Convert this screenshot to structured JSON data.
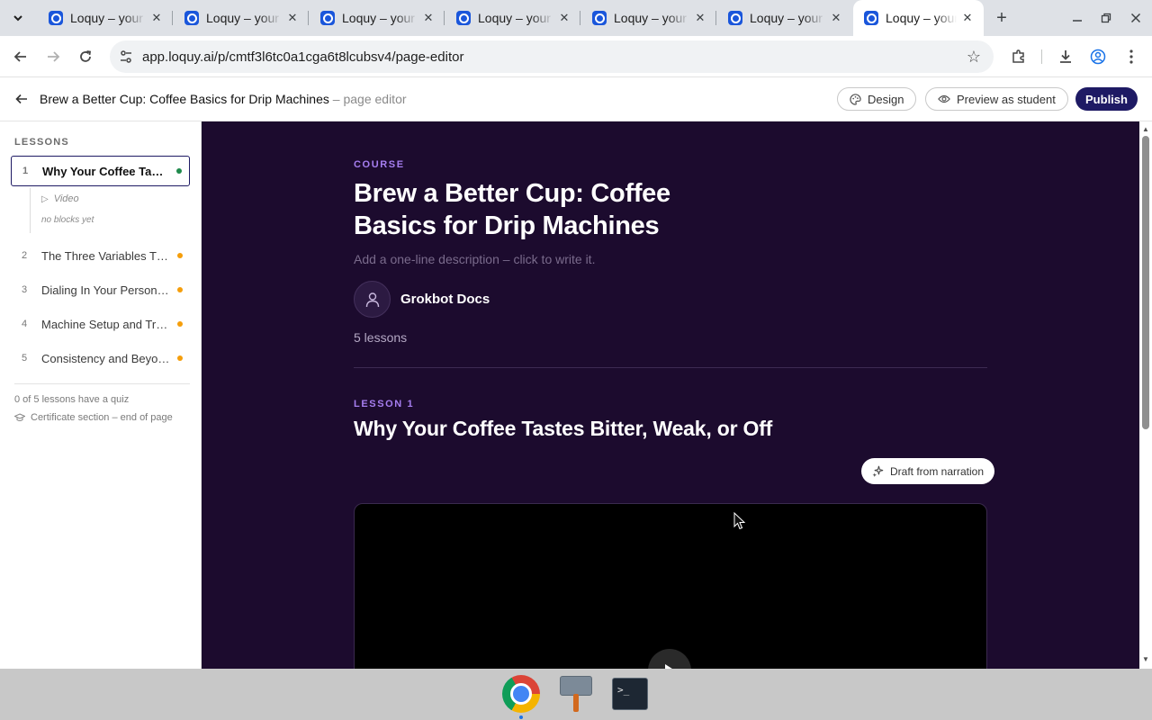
{
  "browser": {
    "tabs": [
      {
        "title": "Loquy – your"
      },
      {
        "title": "Loquy – your"
      },
      {
        "title": "Loquy – your"
      },
      {
        "title": "Loquy – your"
      },
      {
        "title": "Loquy – your"
      },
      {
        "title": "Loquy – your"
      },
      {
        "title": "Loquy – your"
      }
    ],
    "url": "app.loquy.ai/p/cmtf3l6tc0a1cga6t8lcubsv4/page-editor"
  },
  "header": {
    "course_title": "Brew a Better Cup: Coffee Basics for Drip Machines",
    "suffix": " – page editor",
    "design_label": "Design",
    "preview_label": "Preview as student",
    "publish_label": "Publish"
  },
  "sidebar": {
    "heading": "LESSONS",
    "lessons": [
      {
        "num": "1",
        "name": "Why Your Coffee Tastes Bitter, Weak, or Off",
        "status_color": "#1f8a4c"
      },
      {
        "num": "2",
        "name": "The Three Variables That Matter Most",
        "status_color": "#f59e0b"
      },
      {
        "num": "3",
        "name": "Dialing In Your Personal Recipe",
        "status_color": "#f59e0b"
      },
      {
        "num": "4",
        "name": "Machine Setup and Troubleshooting",
        "status_color": "#f59e0b"
      },
      {
        "num": "5",
        "name": "Consistency and Beyond",
        "status_color": "#f59e0b"
      }
    ],
    "sub_video": "Video",
    "sub_empty": "no blocks yet",
    "quiz_note": "0 of 5 lessons have a quiz",
    "certificate_note": "Certificate section – end of page"
  },
  "main": {
    "eyebrow": "COURSE",
    "title": "Brew a Better Cup: Coffee Basics for Drip Machines",
    "description_placeholder": "Add a one-line description – click to write it.",
    "author": "Grokbot Docs",
    "lesson_count": "5 lessons",
    "lesson_eyebrow": "LESSON 1",
    "lesson_title": "Why Your Coffee Tastes Bitter, Weak, or Off",
    "draft_label": "Draft from narration"
  },
  "colors": {
    "accent": "#1e1a64",
    "canvas_bg": "#1c0b2e",
    "eyebrow": "#a67ef0"
  }
}
